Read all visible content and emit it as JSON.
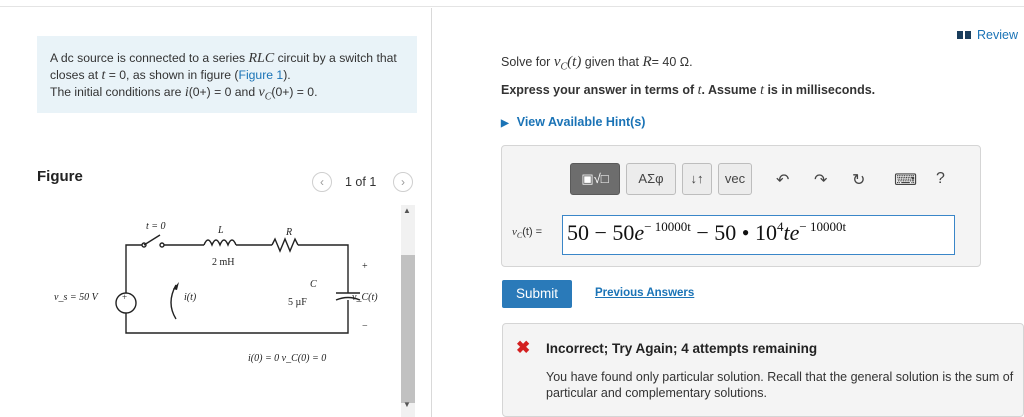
{
  "problem": {
    "text_a": "A dc source is connected to a series ",
    "text_rlc": "RLC",
    "text_b": " circuit by a switch that closes at ",
    "text_t": "t",
    "text_c": " = 0, as shown in figure (",
    "figure_link": "Figure 1",
    "text_d": ").",
    "text_e": "The initial conditions are ",
    "text_i": "i",
    "text_f": "(0+) = 0 and ",
    "text_v": "v",
    "text_vsub": "C",
    "text_g": "(0+) = 0."
  },
  "figure": {
    "title": "Figure",
    "pager": "1 of 1",
    "prev_glyph": "‹",
    "next_glyph": "›",
    "circuit": {
      "switch_label": "t = 0",
      "L_label": "L",
      "L_value": "2 mH",
      "R_label": "R",
      "C_label": "C",
      "C_value": "5 µF",
      "source_label": "v_s = 50 V",
      "current_label": "i(t)",
      "vc_label": "v_C(t)",
      "plus": "+",
      "minus": "−",
      "ic_text": "i(0) = 0    v_C(0) = 0"
    }
  },
  "review": {
    "label": "Review"
  },
  "question": {
    "solve_a": "Solve for ",
    "solve_v": "v",
    "solve_vsub": "C",
    "solve_t": "(t)",
    "solve_b": " given that ",
    "solve_R": "R",
    "solve_c": "= 40 Ω.",
    "express_a": "Express your answer in terms of ",
    "express_t": "t",
    "express_b": ". Assume ",
    "express_t2": "t",
    "express_c": " is in milliseconds.",
    "hints": "View Available Hint(s)"
  },
  "toolbar": {
    "templates": "▣√□",
    "greek": "ΑΣφ",
    "updown": "↓↑",
    "vec": "vec",
    "undo": "↶",
    "redo": "↷",
    "reset": "↻",
    "keyboard": "⌨",
    "help": "?"
  },
  "answer": {
    "label_v": "v",
    "label_sub": "C",
    "label_rest": "(t) =",
    "p1": "50 − 50",
    "e1": "e",
    "exp1": "− 10000t",
    "p2": " − 50 • 10",
    "exp2": "4",
    "p3": "te",
    "exp3": "− 10000t"
  },
  "actions": {
    "submit": "Submit",
    "previous": "Previous Answers"
  },
  "feedback": {
    "icon": "✖",
    "title": "Incorrect; Try Again; 4 attempts remaining",
    "text": "You have found only particular solution. Recall that the general solution is the sum of particular and complementary solutions."
  },
  "colors": {
    "accent": "#1a73b6",
    "submit": "#2a7ab9",
    "error": "#d32020",
    "problem_bg": "#e9f3f8"
  }
}
